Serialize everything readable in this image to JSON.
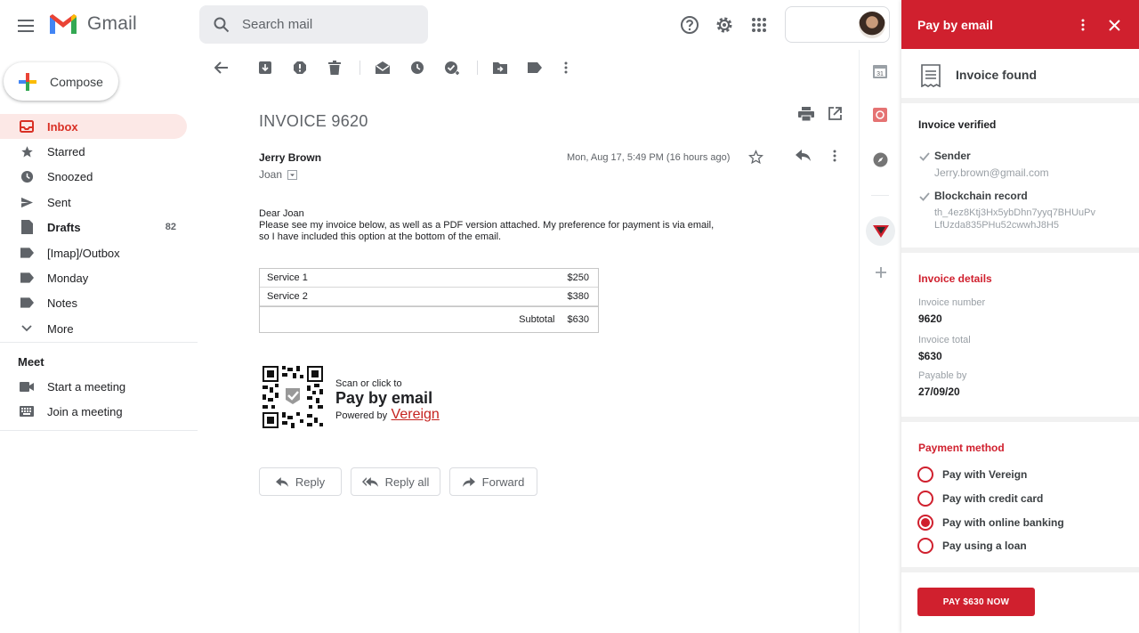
{
  "app": {
    "name": "Gmail"
  },
  "search": {
    "placeholder": "Search mail"
  },
  "sidebar": {
    "compose_label": "Compose",
    "items": [
      {
        "label": "Inbox",
        "icon": "inbox-icon",
        "count": ""
      },
      {
        "label": "Starred",
        "icon": "star-icon",
        "count": ""
      },
      {
        "label": "Snoozed",
        "icon": "clock-icon",
        "count": ""
      },
      {
        "label": "Sent",
        "icon": "send-icon",
        "count": ""
      },
      {
        "label": "Drafts",
        "icon": "draft-icon",
        "count": "82"
      },
      {
        "label": "[Imap]/Outbox",
        "icon": "label-icon",
        "count": ""
      },
      {
        "label": "Monday",
        "icon": "label-icon",
        "count": ""
      },
      {
        "label": "Notes",
        "icon": "label-icon",
        "count": ""
      },
      {
        "label": "More",
        "icon": "chevron-down-icon",
        "count": ""
      }
    ],
    "meet": {
      "title": "Meet",
      "start": "Start a meeting",
      "join": "Join a meeting"
    }
  },
  "email": {
    "subject": "INVOICE 9620",
    "sender": "Jerry Brown",
    "recipient": "Joan",
    "date": "Mon, Aug 17, 5:49 PM (16 hours ago)",
    "greeting": "Dear Joan",
    "body_line1": "Please see my invoice below, as well as a PDF version attached. My preference for payment is via email,",
    "body_line2": "so I have included this option at the bottom of the email.",
    "invoice": {
      "rows": [
        {
          "service": "Service 1",
          "amount": "$250"
        },
        {
          "service": "Service 2",
          "amount": "$380"
        }
      ],
      "subtotal_label": "Subtotal",
      "subtotal": "$630"
    },
    "pay_by_email": {
      "scan": "Scan or click to",
      "title": "Pay by email",
      "powered": "Powered by",
      "link": "Vereign"
    },
    "actions": {
      "reply": "Reply",
      "reply_all": "Reply all",
      "forward": "Forward"
    }
  },
  "panel": {
    "title": "Pay by email",
    "found": "Invoice found",
    "verified_title": "Invoice verified",
    "sender_label": "Sender",
    "sender_value": "Jerry.brown@gmail.com",
    "blockchain_label": "Blockchain record",
    "blockchain_line1": "th_4ez8Ktj3Hx5ybDhn7yyq7BHUuPv",
    "blockchain_line2": "LfUzda835PHu52cwwhJ8H5",
    "details_title": "Invoice details",
    "number_label": "Invoice number",
    "number_value": "9620",
    "total_label": "Invoice total",
    "total_value": "$630",
    "payable_label": "Payable by",
    "payable_value": "27/09/20",
    "method_title": "Payment method",
    "methods": [
      {
        "label": "Pay with Vereign",
        "selected": false
      },
      {
        "label": "Pay with credit card",
        "selected": false
      },
      {
        "label": "Pay with online banking",
        "selected": true
      },
      {
        "label": "Pay using a loan",
        "selected": false
      }
    ],
    "pay_button": "PAY $630 NOW"
  },
  "colors": {
    "accent": "#d0202e",
    "inbox_active_bg": "#fce8e6",
    "link": "#c5221f"
  }
}
